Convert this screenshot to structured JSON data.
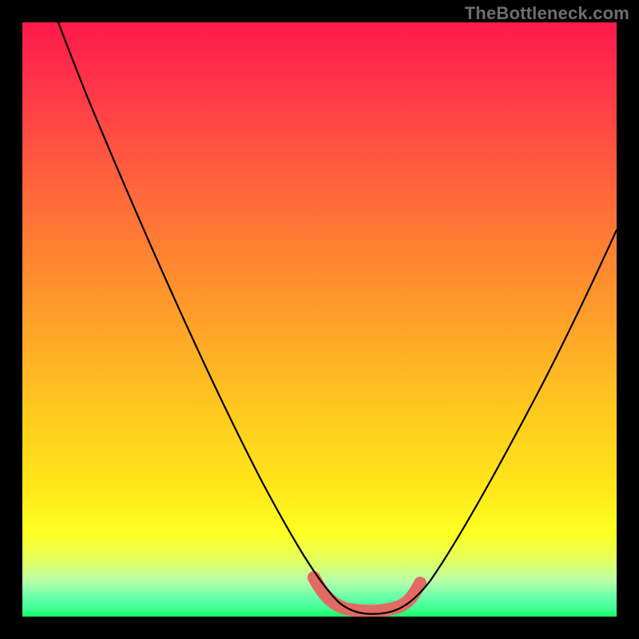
{
  "watermark": {
    "text": "TheBottleneck.com"
  },
  "colors": {
    "frame": "#000000",
    "curve": "#000000",
    "highlight": "#e36a62",
    "gradient_top": "#ff1a4a",
    "gradient_bottom": "#1dff72"
  },
  "chart_data": {
    "type": "line",
    "title": "",
    "xlabel": "",
    "ylabel": "",
    "xlim": [
      0,
      100
    ],
    "ylim": [
      0,
      100
    ],
    "grid": false,
    "legend": "none",
    "background": "red-to-green vertical gradient (high=red at top, low=green at bottom)",
    "series": [
      {
        "name": "bottleneck-curve",
        "color": "#000000",
        "x": [
          6,
          11,
          20,
          30,
          40,
          48,
          52,
          55,
          58,
          62,
          65,
          72,
          80,
          90,
          100
        ],
        "y": [
          100,
          88,
          70,
          50,
          28,
          10,
          3,
          1,
          1,
          2,
          5,
          16,
          32,
          52,
          70
        ]
      },
      {
        "name": "optimal-range-highlight",
        "color": "#e36a62",
        "x": [
          49,
          52,
          55,
          58,
          61,
          64
        ],
        "y": [
          6,
          2,
          1,
          1,
          2,
          5
        ]
      }
    ],
    "annotations": [
      {
        "text": "TheBottleneck.com",
        "position": "top-right",
        "color": "#6e6e6e"
      }
    ]
  }
}
